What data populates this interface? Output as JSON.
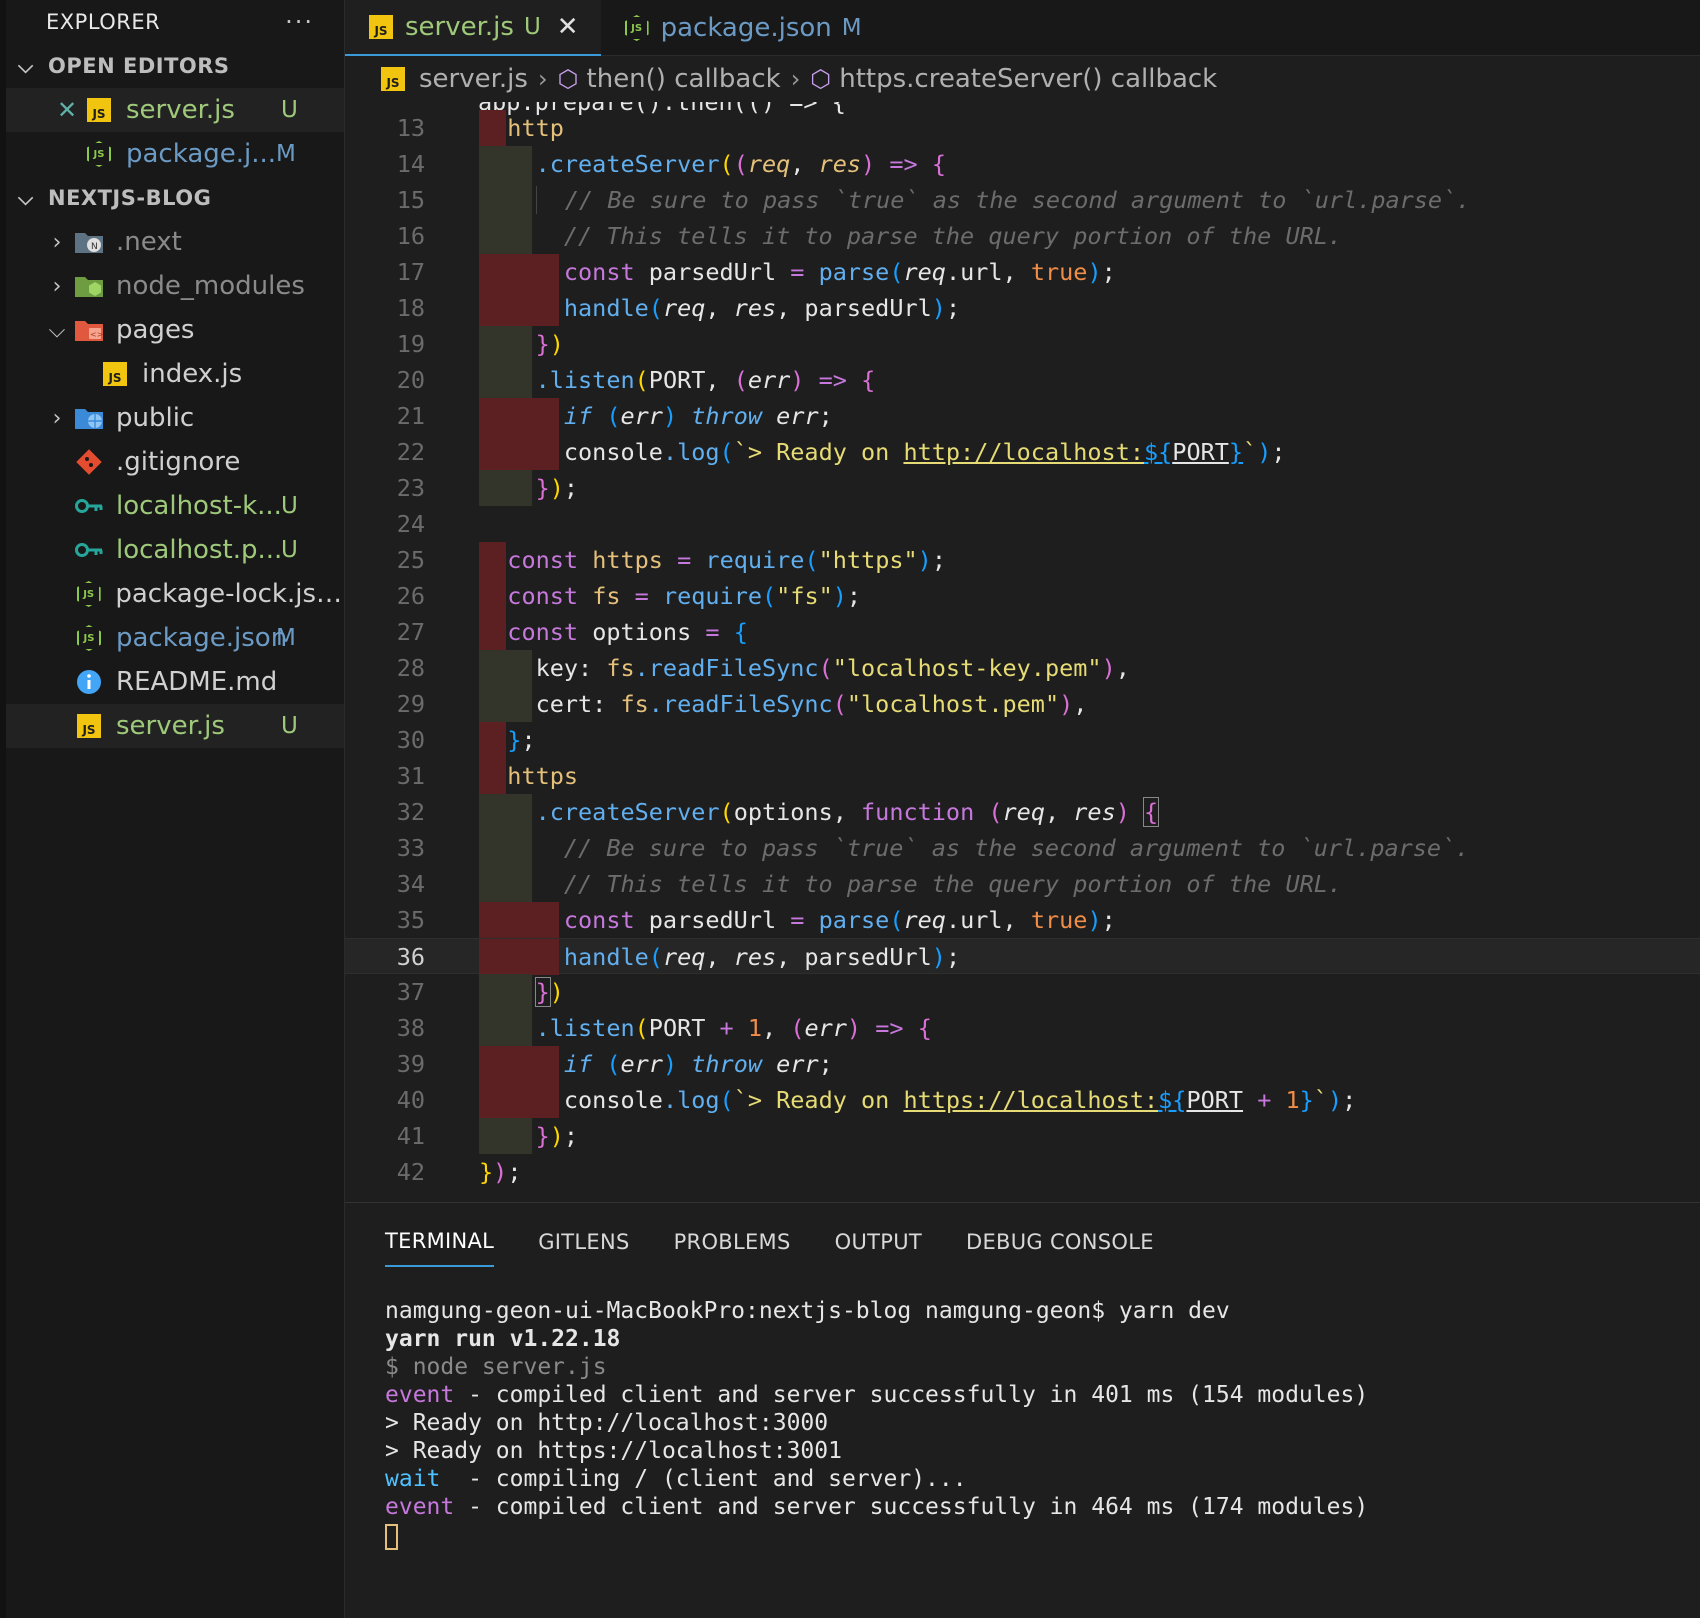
{
  "colors": {
    "accent": "#3a9bd8",
    "untracked": "#73c991",
    "modified": "#6b9ac4",
    "deleted_gutter": "#5c1f22"
  },
  "explorer": {
    "title": "EXPLORER",
    "more": "···",
    "open_editors": {
      "title": "OPEN EDITORS",
      "items": [
        {
          "label": "server.js",
          "badge": "U",
          "icon": "js-icon"
        },
        {
          "label": "package.j...",
          "badge": "M",
          "icon": "nodejs-icon"
        }
      ]
    },
    "project": {
      "title": "NEXTJS-BLOG",
      "items": [
        {
          "label": ".next",
          "badge": "",
          "icon": "next-folder-icon"
        },
        {
          "label": "node_modules",
          "badge": "",
          "icon": "node-folder-icon"
        },
        {
          "label": "pages",
          "badge": "",
          "icon": "pages-folder-icon"
        },
        {
          "label": "index.js",
          "badge": "",
          "icon": "js-icon"
        },
        {
          "label": "public",
          "badge": "",
          "icon": "public-folder-icon"
        },
        {
          "label": ".gitignore",
          "badge": "",
          "icon": "git-icon"
        },
        {
          "label": "localhost-k...",
          "badge": "U",
          "icon": "key-icon"
        },
        {
          "label": "localhost.p...",
          "badge": "U",
          "icon": "key-icon"
        },
        {
          "label": "package-lock.json",
          "badge": "",
          "icon": "nodejs-icon"
        },
        {
          "label": "package.json",
          "badge": "M",
          "icon": "nodejs-icon"
        },
        {
          "label": "README.md",
          "badge": "",
          "icon": "info-icon"
        },
        {
          "label": "server.js",
          "badge": "U",
          "icon": "js-icon"
        }
      ]
    }
  },
  "tabs": [
    {
      "label": "server.js",
      "badge": "U",
      "close": "✕"
    },
    {
      "label": "package.json",
      "badge": "M"
    }
  ],
  "breadcrumb": [
    "server.js",
    "then() callback",
    "https.createServer() callback"
  ],
  "editor": {
    "current_line": 36,
    "line_numbers": [
      "13",
      "14",
      "15",
      "16",
      "17",
      "18",
      "19",
      "20",
      "21",
      "22",
      "23",
      "24",
      "25",
      "26",
      "27",
      "28",
      "29",
      "30",
      "31",
      "32",
      "33",
      "34",
      "35",
      "36",
      "37",
      "38",
      "39",
      "40",
      "41",
      "42"
    ],
    "partial_line": "app.prepare().then(() => {"
  },
  "panel": {
    "tabs": [
      "TERMINAL",
      "GITLENS",
      "PROBLEMS",
      "OUTPUT",
      "DEBUG CONSOLE"
    ],
    "terminal": {
      "prompt_line": "namgung-geon-ui-MacBookPro:nextjs-blog namgung-geon$ yarn dev",
      "yarn_line": "yarn run v1.22.18",
      "node_line": "$ node server.js",
      "event1_tag": "event",
      "event1_text": " - compiled client and server successfully in 401 ms (154 modules)",
      "ready_http": "> Ready on http://localhost:3000",
      "ready_https": "> Ready on https://localhost:3001",
      "wait_tag": "wait",
      "wait_text": "  - compiling / (client and server)...",
      "event2_tag": "event",
      "event2_text": " - compiled client and server successfully in 464 ms (174 modules)"
    }
  }
}
